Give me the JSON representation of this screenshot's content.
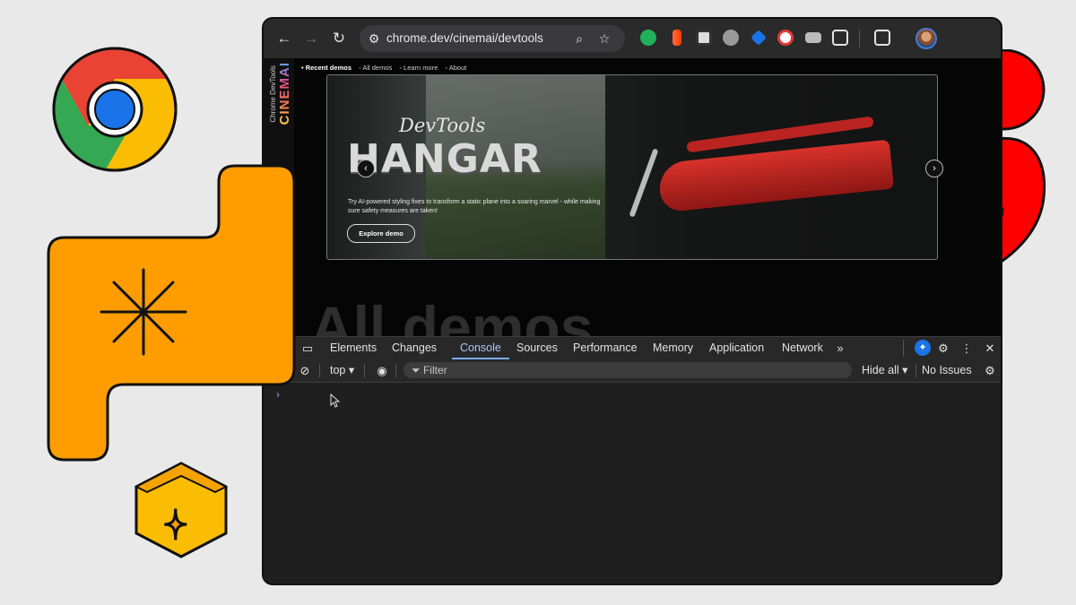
{
  "browser": {
    "url": "chrome.dev/cinemai/devtools",
    "back_icon": "←",
    "forward_icon": "→",
    "reload_icon": "↻",
    "zoom_icon": "⌕",
    "star_icon": "☆"
  },
  "page": {
    "brand_small": "Chrome DevTools",
    "brand_big": "CINEMAI",
    "nav": [
      "Recent demos",
      "All demos",
      "Learn more",
      "About"
    ],
    "hero": {
      "script_title": "DevTools",
      "title": "HANGAR",
      "description": "Try AI-powered styling fixes to transform a static plane into a soaring marvel - while making sure safety measures are taken!",
      "button": "Explore demo",
      "prev": "‹",
      "next": "›"
    },
    "section_heading": "All demos"
  },
  "devtools": {
    "tabs": [
      "Elements",
      "Changes",
      "Console",
      "Sources",
      "Performance",
      "Memory",
      "Application",
      "Network"
    ],
    "active_tab": "Console",
    "more_tabs": "»",
    "console_bar": {
      "context": "top",
      "filter_placeholder": "Filter",
      "levels": "Hide all",
      "issues": "No Issues"
    },
    "prompt": "›"
  },
  "colors": {
    "accent": "#7cacf8",
    "chrome_red": "#ea4335",
    "chrome_green": "#34a853",
    "chrome_yellow": "#fbbc04",
    "chrome_blue": "#4285f4",
    "orange": "#ff9d00",
    "gold": "#ffcc00"
  }
}
